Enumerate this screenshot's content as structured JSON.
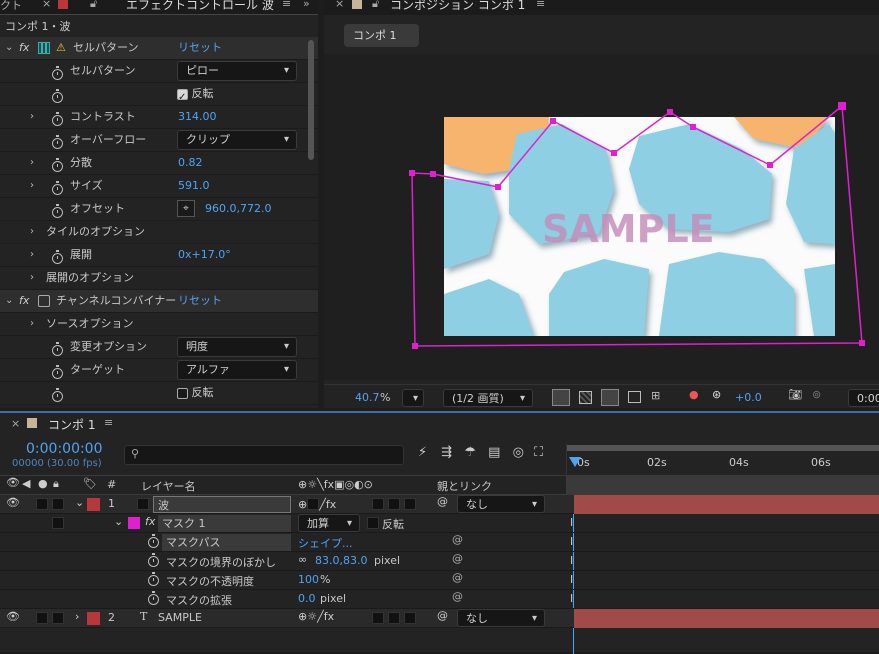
{
  "left_panel": {
    "tab_prev": "クト",
    "tab_close": "×",
    "tab_title": "エフェクトコントロール 波",
    "menu": "≡",
    "arrows": "»",
    "comp_path": "コンポ 1・波",
    "effect1": {
      "name": "セルパターン",
      "reset": "リセット",
      "props": [
        {
          "label": "セルパターン",
          "value": "ピロー"
        },
        {
          "label": "",
          "check_label": "反転",
          "checked": true
        },
        {
          "label": "コントラスト",
          "value": "314.00"
        },
        {
          "label": "オーバーフロー",
          "value": "クリップ"
        },
        {
          "label": "分散",
          "value": "0.82"
        },
        {
          "label": "サイズ",
          "value": "591.0"
        },
        {
          "label": "オフセット",
          "value": "960.0,772.0"
        },
        {
          "label": "タイルのオプション"
        },
        {
          "label": "展開",
          "value": "0x+17.0°"
        },
        {
          "label": "展開のオプション"
        }
      ]
    },
    "effect2": {
      "name": "チャンネルコンバイナー",
      "reset": "リセット",
      "props": [
        {
          "label": "ソースオプション"
        },
        {
          "label": "変更オプション",
          "value": "明度"
        },
        {
          "label": "ターゲット",
          "value": "アルファ"
        },
        {
          "label": "",
          "check_label": "反転",
          "checked": false
        }
      ]
    }
  },
  "comp_panel": {
    "tab_close": "×",
    "tab_title": "コンポジション コンポ 1",
    "menu": "≡",
    "comp_button": "コンポ 1",
    "watermark": "SAMPLE",
    "zoom": "40.7",
    "zoom_unit": "%",
    "quality": "(1/2 画質)",
    "exposure": "+0.0",
    "time_partial": "0:00"
  },
  "timeline": {
    "tab_close": "×",
    "tab_title": "コンポ 1",
    "menu": "≡",
    "timecode": "0:00:00:00",
    "frames": "00000 (30.00 fps)",
    "search_placeholder": "",
    "col_layer_name": "レイヤー名",
    "col_num": "#",
    "col_parent": "親とリンク",
    "ruler": [
      "0s",
      "02s",
      "04s",
      "06s"
    ],
    "layers": [
      {
        "num": "1",
        "name": "波",
        "parent": "なし",
        "color": "#b8373a"
      },
      {
        "num": "2",
        "name": "SAMPLE",
        "parent": "なし",
        "color": "#b8373a"
      }
    ],
    "mask": {
      "name": "マスク 1",
      "mode": "加算",
      "invert_label": "反転",
      "props": [
        {
          "label": "マスクパス",
          "value": "シェイプ..."
        },
        {
          "label": "マスクの境界のぼかし",
          "value": "83.0,83.0",
          "unit": "pixel"
        },
        {
          "label": "マスクの不透明度",
          "value": "100",
          "unit": "%"
        },
        {
          "label": "マスクの拡張",
          "value": "0.0",
          "unit": "pixel"
        }
      ]
    }
  },
  "colors": {
    "accent": "#4ea4f4",
    "mask": "#e020d0",
    "layer_label": "#b8373a",
    "cell_blue": "#8ecfe4",
    "cell_orange": "#f6b46e"
  }
}
